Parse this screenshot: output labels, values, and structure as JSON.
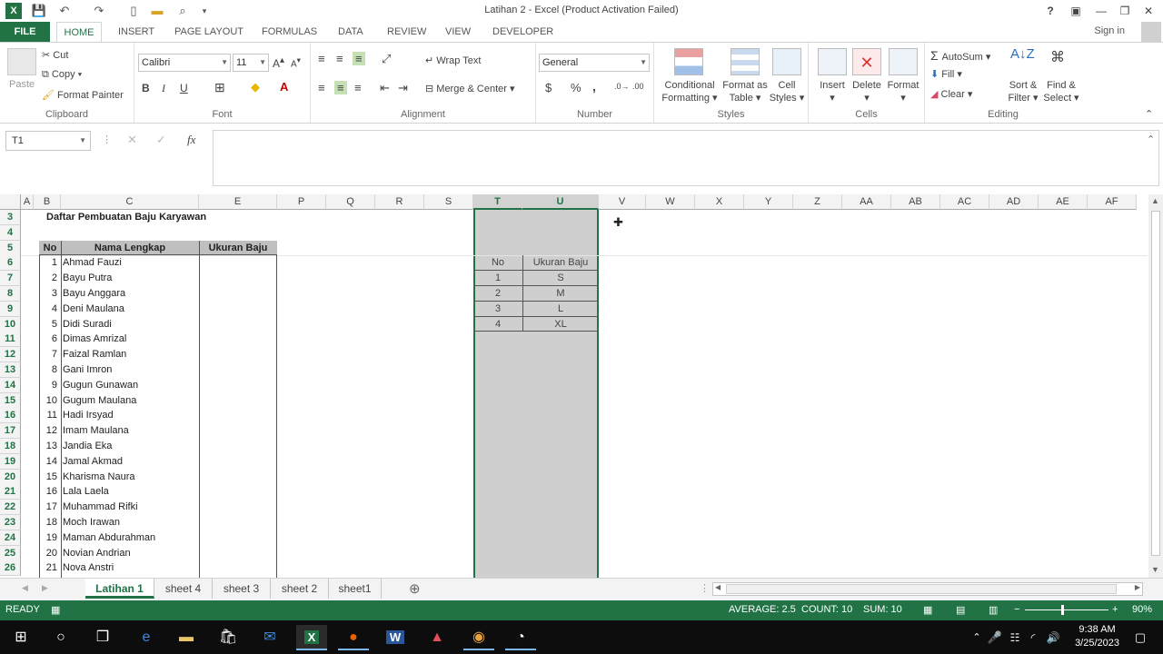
{
  "window": {
    "title": "Latihan 2 - Excel (Product Activation Failed)",
    "help": "?",
    "minimize": "—",
    "restore": "❐",
    "close": "✕"
  },
  "ribbon_tabs": [
    "FILE",
    "HOME",
    "INSERT",
    "PAGE LAYOUT",
    "FORMULAS",
    "DATA",
    "REVIEW",
    "VIEW",
    "DEVELOPER"
  ],
  "signin": "Sign in",
  "clipboard": {
    "paste": "Paste",
    "cut": "Cut",
    "copy": "Copy",
    "format_painter": "Format Painter",
    "label": "Clipboard"
  },
  "font": {
    "name": "Calibri",
    "size": "11",
    "label": "Font",
    "bold": "B",
    "italic": "I",
    "underline": "U"
  },
  "alignment": {
    "wrap": "Wrap Text",
    "merge": "Merge & Center",
    "label": "Alignment"
  },
  "number": {
    "format": "General",
    "label": "Number",
    "currency": "$",
    "percent": "%",
    "comma": ","
  },
  "styles": {
    "conditional": "Conditional",
    "conditional2": "Formatting",
    "format_table": "Format as",
    "format_table2": "Table",
    "cell_styles": "Cell",
    "cell_styles2": "Styles",
    "label": "Styles"
  },
  "cells": {
    "insert": "Insert",
    "delete": "Delete",
    "format": "Format",
    "label": "Cells"
  },
  "editing": {
    "autosum": "AutoSum",
    "fill": "Fill",
    "clear": "Clear",
    "sort": "Sort &",
    "sort2": "Filter",
    "find": "Find &",
    "find2": "Select",
    "label": "Editing"
  },
  "formula_bar": {
    "name_box": "T1",
    "fx": "fx",
    "content": ""
  },
  "columns": [
    "A",
    "B",
    "C",
    "E",
    "P",
    "Q",
    "R",
    "S",
    "T",
    "U",
    "V",
    "W",
    "X",
    "Y",
    "Z",
    "AA",
    "AB",
    "AC",
    "AD",
    "AE",
    "AF"
  ],
  "rows": [
    "3",
    "4",
    "5",
    "6",
    "7",
    "8",
    "9",
    "10",
    "11",
    "12",
    "13",
    "14",
    "15",
    "16",
    "17",
    "18",
    "19",
    "20",
    "21",
    "22",
    "23",
    "24",
    "25",
    "26"
  ],
  "sheet_title": "Daftar Pembuatan Baju Karyawan",
  "table_headers": {
    "no": "No",
    "nama": "Nama Lengkap",
    "ukuran": "Ukuran Baju"
  },
  "employees": [
    {
      "no": "1",
      "name": "Ahmad Fauzi"
    },
    {
      "no": "2",
      "name": "Bayu Putra"
    },
    {
      "no": "3",
      "name": "Bayu Anggara"
    },
    {
      "no": "4",
      "name": "Deni Maulana"
    },
    {
      "no": "5",
      "name": "Didi Suradi"
    },
    {
      "no": "6",
      "name": "Dimas Amrizal"
    },
    {
      "no": "7",
      "name": "Faizal Ramlan"
    },
    {
      "no": "8",
      "name": "Gani Imron"
    },
    {
      "no": "9",
      "name": "Gugun Gunawan"
    },
    {
      "no": "10",
      "name": "Gugum Maulana"
    },
    {
      "no": "11",
      "name": "Hadi Irsyad"
    },
    {
      "no": "12",
      "name": "Imam Maulana"
    },
    {
      "no": "13",
      "name": "Jandia Eka"
    },
    {
      "no": "14",
      "name": "Jamal Akmad"
    },
    {
      "no": "15",
      "name": "Kharisma Naura"
    },
    {
      "no": "16",
      "name": "Lala Laela"
    },
    {
      "no": "17",
      "name": "Muhammad Rifki"
    },
    {
      "no": "18",
      "name": "Moch Irawan"
    },
    {
      "no": "19",
      "name": "Maman Abdurahman"
    },
    {
      "no": "20",
      "name": "Novian Andrian"
    },
    {
      "no": "21",
      "name": "Nova Anstri"
    }
  ],
  "size_table": {
    "headers": [
      "No",
      "Ukuran Baju"
    ],
    "rows": [
      [
        "1",
        "S"
      ],
      [
        "2",
        "M"
      ],
      [
        "3",
        "L"
      ],
      [
        "4",
        "XL"
      ]
    ]
  },
  "sheets": [
    "Latihan 1",
    "sheet 4",
    "sheet 3",
    "sheet 2",
    "sheet1"
  ],
  "status": {
    "ready": "READY",
    "average": "AVERAGE: 2.5",
    "count": "COUNT: 10",
    "sum": "SUM: 10",
    "zoom": "90%"
  },
  "clock": {
    "time": "9:38 AM",
    "date": "3/25/2023"
  }
}
